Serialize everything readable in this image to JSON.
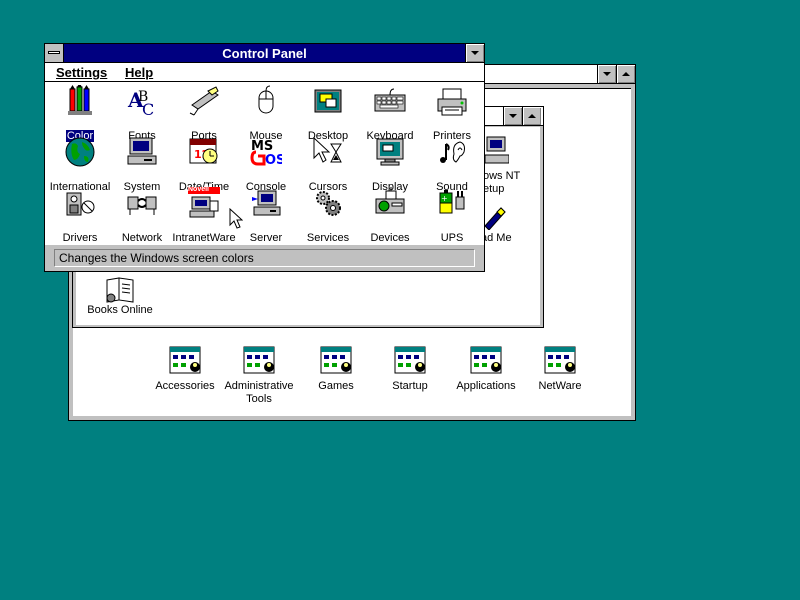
{
  "program_manager": {
    "main_group": {
      "partial_items": [
        "ows NT",
        "etup",
        "ad Me"
      ],
      "books_online_label": "Books Online"
    },
    "groups": [
      {
        "label": "Accessories"
      },
      {
        "label": "Administrative Tools"
      },
      {
        "label": "Games"
      },
      {
        "label": "Startup"
      },
      {
        "label": "Applications"
      },
      {
        "label": "NetWare"
      }
    ]
  },
  "control_panel": {
    "title": "Control Panel",
    "menu": {
      "settings": "Settings",
      "help": "Help"
    },
    "icons": [
      {
        "label": "Color",
        "icon": "color-icon",
        "selected": true
      },
      {
        "label": "Fonts",
        "icon": "fonts-icon"
      },
      {
        "label": "Ports",
        "icon": "ports-icon"
      },
      {
        "label": "Mouse",
        "icon": "mouse-icon"
      },
      {
        "label": "Desktop",
        "icon": "desktop-icon"
      },
      {
        "label": "Keyboard",
        "icon": "keyboard-icon"
      },
      {
        "label": "Printers",
        "icon": "printers-icon"
      },
      {
        "label": "International",
        "icon": "globe-icon"
      },
      {
        "label": "System",
        "icon": "system-icon"
      },
      {
        "label": "Date/Time",
        "icon": "calendar-clock-icon"
      },
      {
        "label": "Console",
        "icon": "msdos-icon"
      },
      {
        "label": "Cursors",
        "icon": "cursor-hourglass-icon"
      },
      {
        "label": "Display",
        "icon": "display-icon"
      },
      {
        "label": "Sound",
        "icon": "music-note-ear-icon"
      },
      {
        "label": "Drivers",
        "icon": "drivers-icon"
      },
      {
        "label": "Network",
        "icon": "network-icon"
      },
      {
        "label": "IntranetWare",
        "icon": "novell-icon",
        "badge": "Novell"
      },
      {
        "label": "Server",
        "icon": "server-icon"
      },
      {
        "label": "Services",
        "icon": "gears-icon"
      },
      {
        "label": "Devices",
        "icon": "devices-icon"
      },
      {
        "label": "UPS",
        "icon": "battery-plug-icon"
      }
    ],
    "status_text": "Changes the Windows screen colors"
  },
  "colors": {
    "desktop": "#008080",
    "active_title": "#000080",
    "selection": "#000080"
  }
}
